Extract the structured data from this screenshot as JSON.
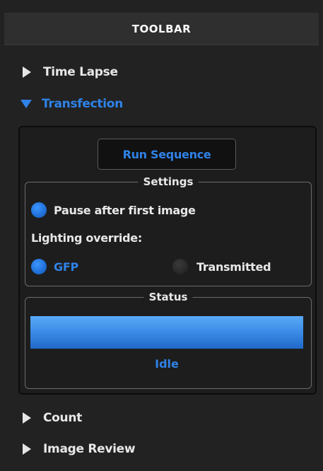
{
  "toolbar": {
    "title": "TOOLBAR"
  },
  "sections": {
    "time_lapse": {
      "label": "Time Lapse",
      "expanded": false
    },
    "transfection": {
      "label": "Transfection",
      "expanded": true
    },
    "count": {
      "label": "Count",
      "expanded": false
    },
    "image_review": {
      "label": "Image Review",
      "expanded": false
    }
  },
  "transfection": {
    "run_button_label": "Run Sequence",
    "settings": {
      "title": "Settings",
      "pause_after_first_image": {
        "label": "Pause after first image",
        "checked": true
      },
      "lighting_override_label": "Lighting override:",
      "lighting_options": [
        {
          "label": "GFP",
          "selected": true
        },
        {
          "label": "Transmitted",
          "selected": false
        }
      ]
    },
    "status": {
      "title": "Status",
      "progress_percent": 100,
      "text": "Idle"
    }
  },
  "colors": {
    "accent": "#2f82e8",
    "background": "#222222",
    "text": "#e8e8e8"
  }
}
